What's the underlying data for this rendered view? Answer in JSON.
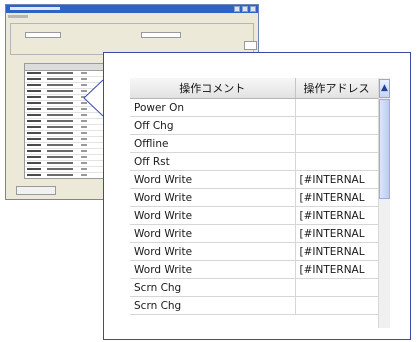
{
  "table": {
    "columns": [
      "操作コメント",
      "操作アドレス"
    ],
    "rows": [
      {
        "comment": "Power On",
        "address": ""
      },
      {
        "comment": "Off Chg",
        "address": ""
      },
      {
        "comment": "Offline",
        "address": ""
      },
      {
        "comment": "Off Rst",
        "address": ""
      },
      {
        "comment": "Word Write",
        "address": "[#INTERNAL"
      },
      {
        "comment": "Word Write",
        "address": "[#INTERNAL"
      },
      {
        "comment": "Word Write",
        "address": "[#INTERNAL"
      },
      {
        "comment": "Word Write",
        "address": "[#INTERNAL"
      },
      {
        "comment": "Word Write",
        "address": "[#INTERNAL"
      },
      {
        "comment": "Word Write",
        "address": "[#INTERNAL"
      },
      {
        "comment": "Scrn Chg",
        "address": ""
      },
      {
        "comment": "Scrn Chg",
        "address": ""
      }
    ]
  },
  "icons": {
    "scroll_up": "scroll-up-arrow-icon"
  },
  "colors": {
    "callout_border": "#3a49a8",
    "titlebar": "#2c63c4",
    "scroll_thumb": "#bccdf2"
  }
}
